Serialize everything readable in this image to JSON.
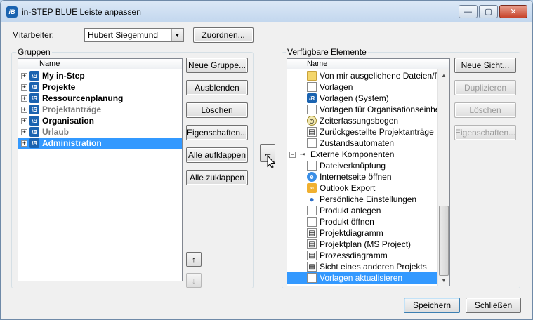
{
  "window": {
    "title": "in-STEP BLUE Leiste anpassen",
    "app_icon_text": "iB",
    "min_glyph": "—",
    "max_glyph": "▢",
    "close_glyph": "✕"
  },
  "top": {
    "employee_label": "Mitarbeiter:",
    "employee_value": "Hubert Siegemund",
    "assign_button": "Zuordnen..."
  },
  "groups": {
    "legend": "Gruppen",
    "column_name": "Name",
    "items": [
      {
        "label": "My in-Step",
        "grey": false,
        "selected": false
      },
      {
        "label": "Projekte",
        "grey": false,
        "selected": false
      },
      {
        "label": "Ressourcenplanung",
        "grey": false,
        "selected": false
      },
      {
        "label": "Projektanträge",
        "grey": true,
        "selected": false
      },
      {
        "label": "Organisation",
        "grey": false,
        "selected": false
      },
      {
        "label": "Urlaub",
        "grey": true,
        "selected": false
      },
      {
        "label": "Administration",
        "grey": false,
        "selected": true
      }
    ],
    "buttons": {
      "new_group": "Neue Gruppe...",
      "hide": "Ausblenden",
      "delete": "Löschen",
      "properties": "Eigenschaften...",
      "expand_all": "Alle aufklappen",
      "collapse_all": "Alle zuklappen"
    }
  },
  "available": {
    "legend": "Verfügbare Elemente",
    "column_name": "Name",
    "items": [
      {
        "label": "Von mir ausgeliehene Dateien/Proc",
        "icon": "folder",
        "indent": 2
      },
      {
        "label": "Vorlagen",
        "icon": "doc",
        "indent": 2
      },
      {
        "label": "Vorlagen (System)",
        "icon": "ib",
        "indent": 2
      },
      {
        "label": "Vorlagen für Organisationseinheiten",
        "icon": "doc",
        "indent": 2
      },
      {
        "label": "Zeiterfassungsbogen",
        "icon": "clock",
        "indent": 2
      },
      {
        "label": "Zurückgestellte Projektanträge",
        "icon": "chart",
        "indent": 2
      },
      {
        "label": "Zustandsautomaten",
        "icon": "doc",
        "indent": 2
      },
      {
        "label": "Externe Komponenten",
        "icon": "key",
        "indent": 1
      },
      {
        "label": "Dateiverknüpfung",
        "icon": "doc",
        "indent": 2
      },
      {
        "label": "Internetseite öffnen",
        "icon": "globe",
        "indent": 2
      },
      {
        "label": "Outlook Export",
        "icon": "outlook",
        "indent": 2
      },
      {
        "label": "Persönliche Einstellungen",
        "icon": "person",
        "indent": 2
      },
      {
        "label": "Produkt anlegen",
        "icon": "doc",
        "indent": 2
      },
      {
        "label": "Produkt öffnen",
        "icon": "doc",
        "indent": 2
      },
      {
        "label": "Projektdiagramm",
        "icon": "chart",
        "indent": 2
      },
      {
        "label": "Projektplan (MS Project)",
        "icon": "chart",
        "indent": 2
      },
      {
        "label": "Prozessdiagramm",
        "icon": "chart",
        "indent": 2
      },
      {
        "label": "Sicht eines anderen Projekts",
        "icon": "chart",
        "indent": 2
      },
      {
        "label": "Vorlagen aktualisieren",
        "icon": "doc",
        "indent": 2,
        "selected": true
      }
    ],
    "buttons": {
      "new_view": "Neue Sicht...",
      "duplicate": "Duplizieren",
      "delete": "Löschen",
      "properties": "Eigenschaften..."
    }
  },
  "transfer_glyph": "←",
  "move_up_glyph": "↑",
  "move_down_glyph": "↓",
  "footer": {
    "save": "Speichern",
    "close": "Schließen"
  }
}
